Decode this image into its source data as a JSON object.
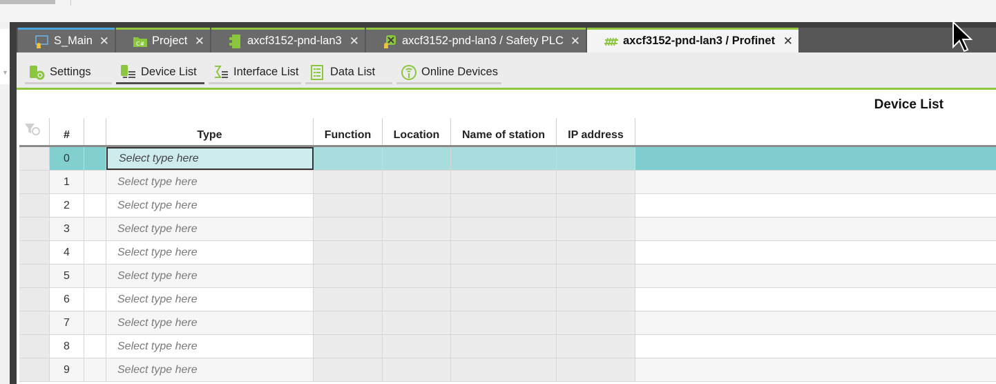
{
  "tabs": [
    {
      "label": "S_Main",
      "icon": "screen-user-icon",
      "active": false
    },
    {
      "label": "Project",
      "icon": "folder-icon",
      "active": false
    },
    {
      "label": "axcf3152-pnd-lan3",
      "icon": "controller-icon",
      "active": false
    },
    {
      "label": "axcf3152-pnd-lan3 / Safety PLC",
      "icon": "safety-plc-icon",
      "active": false
    },
    {
      "label": "axcf3152-pnd-lan3 / Profinet",
      "icon": "profinet-icon",
      "active": true
    }
  ],
  "subtabs": [
    {
      "label": "Settings",
      "icon": "settings-gear-icon"
    },
    {
      "label": "Device List",
      "icon": "device-list-icon",
      "active": true
    },
    {
      "label": "Interface List",
      "icon": "interface-list-icon"
    },
    {
      "label": "Data List",
      "icon": "data-list-icon"
    },
    {
      "label": "Online Devices",
      "icon": "online-devices-icon"
    }
  ],
  "main": {
    "title": "Device List"
  },
  "table": {
    "headers": {
      "num": "#",
      "type": "Type",
      "function": "Function",
      "location": "Location",
      "name_of_station": "Name of station",
      "ip_address": "IP address"
    },
    "rows": [
      {
        "num": "0",
        "type": "Select type here"
      },
      {
        "num": "1",
        "type": "Select type here"
      },
      {
        "num": "2",
        "type": "Select type here"
      },
      {
        "num": "3",
        "type": "Select type here"
      },
      {
        "num": "4",
        "type": "Select type here"
      },
      {
        "num": "5",
        "type": "Select type here"
      },
      {
        "num": "6",
        "type": "Select type here"
      },
      {
        "num": "7",
        "type": "Select type here"
      },
      {
        "num": "8",
        "type": "Select type here"
      },
      {
        "num": "9",
        "type": "Select type here"
      }
    ],
    "selected_row": 0
  },
  "colors": {
    "accent_green": "#8cc63f",
    "accent_blue": "#49a7dd",
    "selection_teal": "#82cfd0",
    "tabbar_dark": "#575757"
  }
}
